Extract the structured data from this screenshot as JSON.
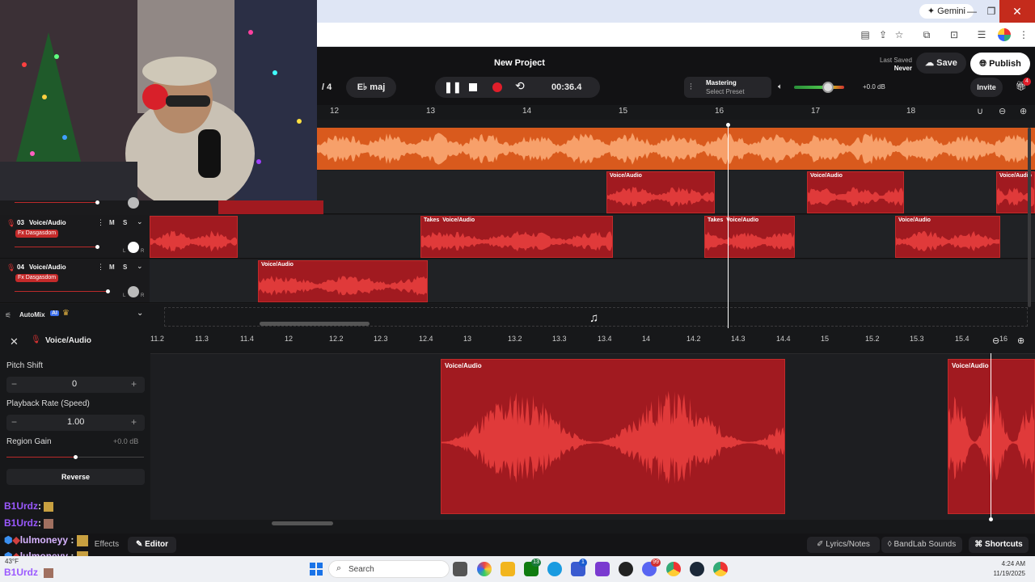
{
  "browser": {
    "gemini_label": "Gemini",
    "minimize": "—",
    "maximize": "❐",
    "close": "✕"
  },
  "header": {
    "project_title": "New Project",
    "last_saved_label": "Last Saved",
    "last_saved_value": "Never",
    "save_label": "Save",
    "publish_label": "Publish",
    "time_sig": "/ 4",
    "key": "E♭ maj",
    "time": "00:36.4",
    "mastering_label": "Mastering",
    "preset_label": "Select Preset",
    "volume_db": "+0.0 dB",
    "invite_label": "Invite",
    "gift_badge": "4"
  },
  "timeline": {
    "ticks": [
      "12",
      "13",
      "14",
      "15",
      "16",
      "17",
      "18"
    ]
  },
  "tracks": [
    {
      "number": "03",
      "name": "Voice/Audio",
      "fx": "Fx Dasgasdom",
      "mute": "M",
      "solo": "S",
      "pan_l": "L",
      "pan_r": "R"
    },
    {
      "number": "04",
      "name": "Voice/Audio",
      "fx": "Fx Dasgasdom",
      "mute": "M",
      "solo": "S",
      "pan_l": "L",
      "pan_r": "R"
    }
  ],
  "clips": {
    "voice_label": "Voice/Audio",
    "takes_label": "Takes"
  },
  "automix": {
    "label": "AutoMix",
    "ai": "AI",
    "crown": "♛"
  },
  "editor": {
    "title": "Voice/Audio",
    "pitch_label": "Pitch Shift",
    "pitch_value": "0",
    "rate_label": "Playback Rate (Speed)",
    "rate_value": "1.00",
    "gain_label": "Region Gain",
    "gain_value": "+0.0 dB",
    "reverse_label": "Reverse",
    "ruler": [
      "11.2",
      "11.3",
      "11.4",
      "12",
      "12.2",
      "12.3",
      "12.4",
      "13",
      "13.2",
      "13.3",
      "13.4",
      "14",
      "14.2",
      "14.3",
      "14.4",
      "15",
      "15.2",
      "15.3",
      "15.4",
      "16"
    ],
    "clip_label": "Voice/Audio"
  },
  "bottom": {
    "effects": "Effects",
    "editor": "Editor",
    "lyrics": "Lyrics/Notes",
    "sounds": "BandLab Sounds",
    "shortcuts": "Shortcuts"
  },
  "chat": [
    {
      "user": "B1Urdz",
      "sep": ":",
      "color": "#9b59ff"
    },
    {
      "user": "B1Urdz",
      "sep": ":",
      "color": "#9b59ff"
    },
    {
      "user": "lulmoneyy",
      "sep": ":",
      "color": "#d7b3ff"
    },
    {
      "user": "lulmoneyy",
      "sep": ":",
      "color": "#d7b3ff"
    },
    {
      "user": "B1Urdz",
      "sep": ":",
      "color": "#9b59ff"
    }
  ],
  "taskbar": {
    "search": "Search",
    "time": "4:24 AM",
    "date": "11/19/2025",
    "weather": "43°F",
    "badge_teams": "13",
    "badge_store": "1",
    "badge_discord": "99"
  },
  "colors": {
    "accent_red": "#a11a20",
    "orange_wave": "#ef6a24",
    "brand_dark": "#121214"
  }
}
